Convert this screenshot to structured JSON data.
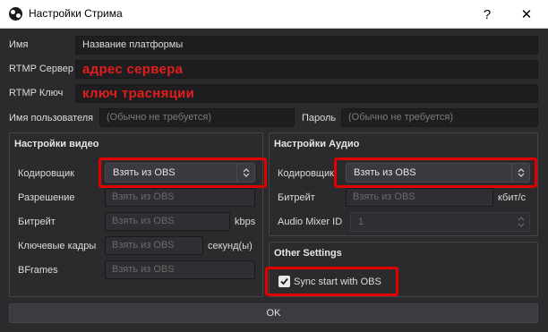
{
  "window": {
    "title": "Настройки Стрима",
    "help_label": "?",
    "close_label": "✕"
  },
  "name": {
    "label": "Имя",
    "value": "Название платформы"
  },
  "rtmp_server": {
    "label": "RTMP Сервер",
    "value": "адрес сервера"
  },
  "rtmp_key": {
    "label": "RTMP Ключ",
    "value": "ключ трасняции"
  },
  "username": {
    "label": "Имя пользователя",
    "placeholder": "(Обычно не требуется)"
  },
  "password": {
    "label": "Пароль",
    "placeholder": "(Обычно не требуется)"
  },
  "video": {
    "title": "Настройки видео",
    "encoder": {
      "label": "Кодировщик",
      "value": "Взять из OBS"
    },
    "resolution": {
      "label": "Разрешение",
      "placeholder": "Взять из OBS"
    },
    "bitrate": {
      "label": "Битрейт",
      "placeholder": "Взять из OBS",
      "unit": "kbps"
    },
    "keyframes": {
      "label": "Ключевые кадры",
      "placeholder": "Взять из OBS",
      "unit": "секунд(ы)"
    },
    "bframes": {
      "label": "BFrames",
      "placeholder": "Взять из OBS"
    }
  },
  "audio": {
    "title": "Настройки Аудио",
    "encoder": {
      "label": "Кодировщик",
      "value": "Взять из OBS"
    },
    "bitrate": {
      "label": "Битрейт",
      "placeholder": "Взять из OBS",
      "unit": "кбит/с"
    },
    "mixer": {
      "label": "Audio Mixer ID",
      "value": "1"
    }
  },
  "other": {
    "title": "Other Settings",
    "sync_label": "Sync start with OBS",
    "sync_checked": true
  },
  "ok_label": "OK",
  "colors": {
    "highlight": "#e10000",
    "red_text": "#e31c1c",
    "background": "#2b2b2e"
  }
}
